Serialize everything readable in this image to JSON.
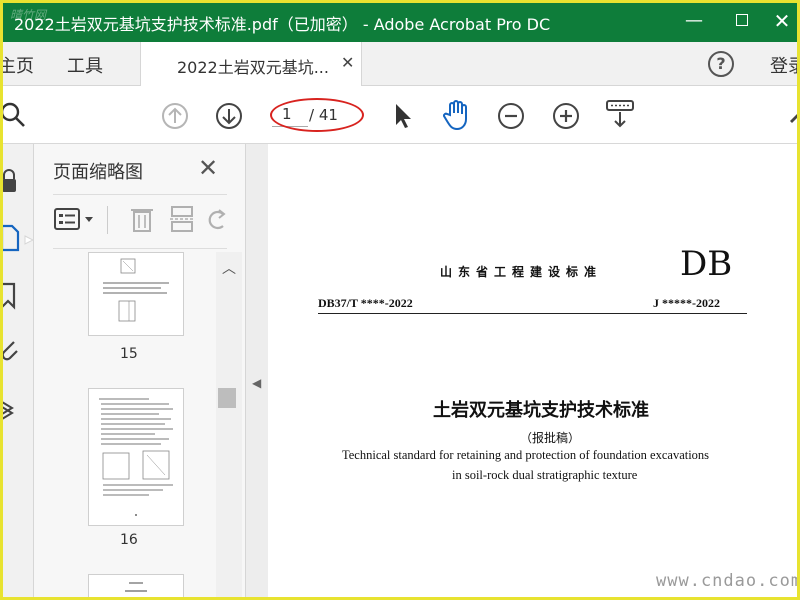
{
  "window": {
    "title": "2022土岩双元基坑支护技术标准.pdf（已加密） - Adobe Acrobat Pro DC",
    "watermark": "晴竹网"
  },
  "menu": {
    "home": "主页",
    "tools": "工具",
    "doc_tab": "2022土岩双元基坑...",
    "login": "登录"
  },
  "toolbar": {
    "current_page": "1",
    "total_pages": "/ 41"
  },
  "thumbnails_panel": {
    "title": "页面缩略图",
    "pages": [
      {
        "number": "15"
      },
      {
        "number": "16"
      }
    ]
  },
  "document": {
    "issuer": "山东省工程建设标准",
    "code_mark": "DB",
    "std_number": "DB37/T ****-2022",
    "j_number": "J *****-2022",
    "title_cn": "土岩双元基坑支护技术标准",
    "subtitle": "（报批稿）",
    "title_en_1": "Technical standard for retaining and protection of foundation excavations",
    "title_en_2": "in soil-rock dual stratigraphic texture"
  },
  "site_watermark": "www.cndao.com",
  "colors": {
    "titlebar": "#0e7d3a",
    "frame": "#e8e330",
    "hand_tool": "#1565c0",
    "annotation": "#d8231f"
  }
}
